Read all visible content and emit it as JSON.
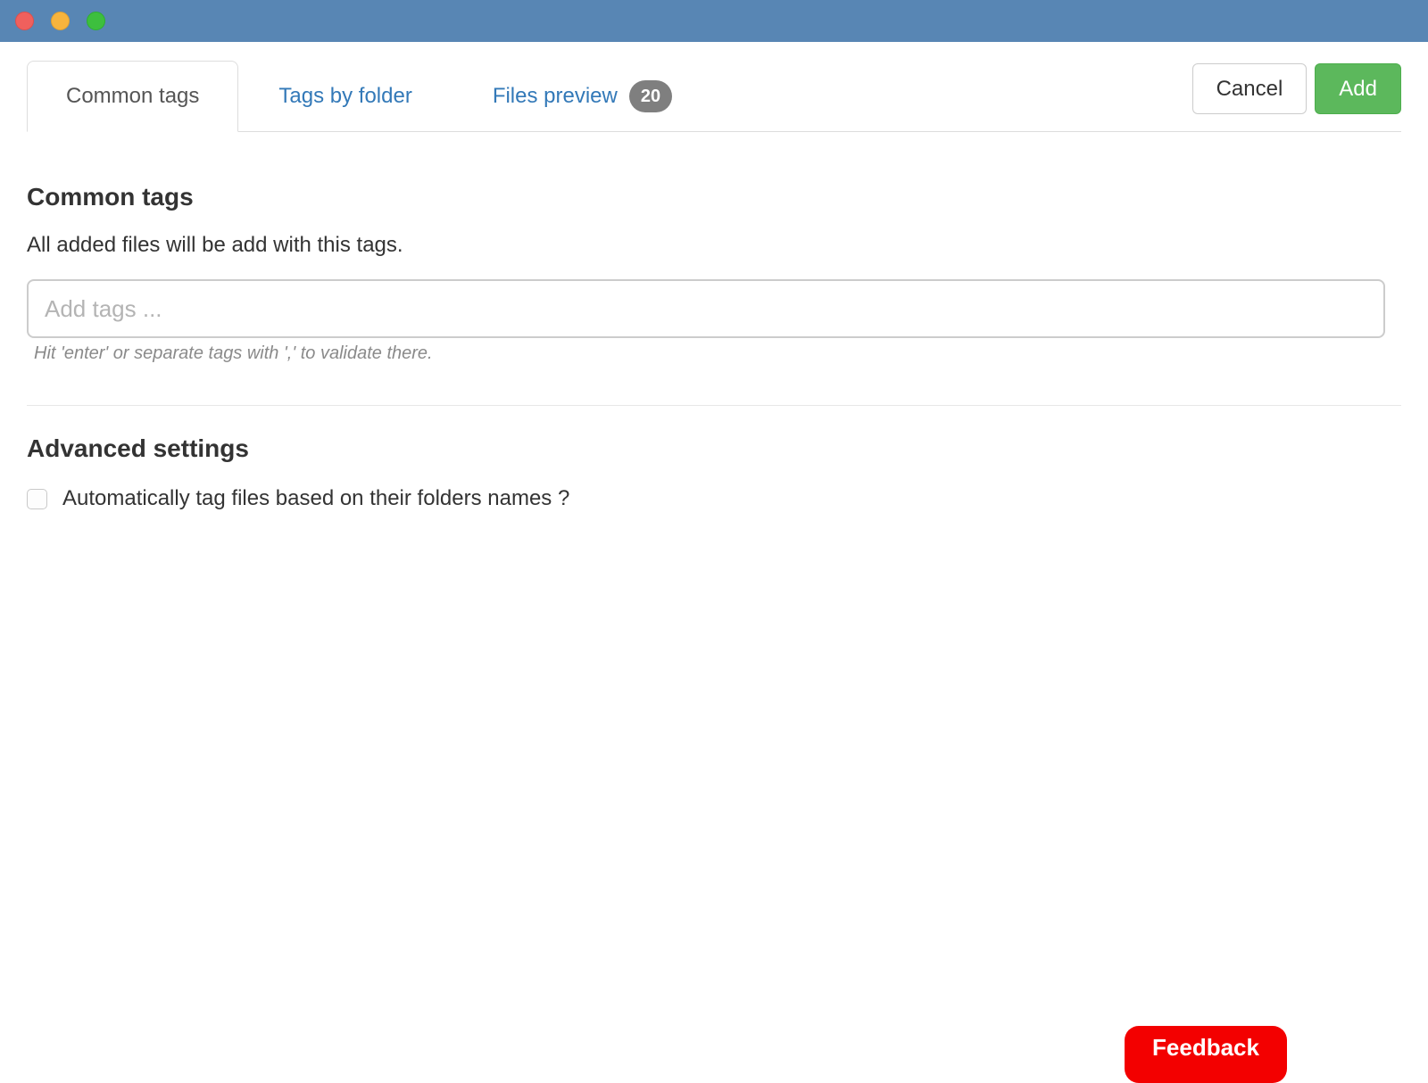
{
  "titlebar": {
    "traffic_lights": [
      {
        "name": "close",
        "color": "#f0605d"
      },
      {
        "name": "minimize",
        "color": "#f7b43d"
      },
      {
        "name": "zoom",
        "color": "#3dbf3e"
      }
    ],
    "color": "#5886b4"
  },
  "tabs": {
    "items": [
      {
        "label": "Common tags",
        "active": true
      },
      {
        "label": "Tags by folder",
        "active": false
      },
      {
        "label": "Files preview",
        "active": false,
        "badge": "20"
      }
    ]
  },
  "actions": {
    "cancel": "Cancel",
    "add": "Add"
  },
  "common_tags": {
    "heading": "Common tags",
    "description": "All added files will be add with this tags.",
    "placeholder": "Add tags ...",
    "input_value": "",
    "hint": "Hit 'enter' or separate tags with ',' to validate there."
  },
  "advanced_settings": {
    "heading": "Advanced settings",
    "checkbox_label": "Automatically tag files based on their folders names ?",
    "checkbox_checked": false
  },
  "feedback": {
    "label": "Feedback",
    "color": "#f30000"
  },
  "colors": {
    "titlebar": "#5886b4",
    "tab_link": "#3379b8",
    "active_tab_text": "#555555",
    "border": "#dddddd",
    "badge_bg": "#7f7f7f",
    "add_button": "#5cb85c",
    "feedback_button": "#f30000"
  }
}
